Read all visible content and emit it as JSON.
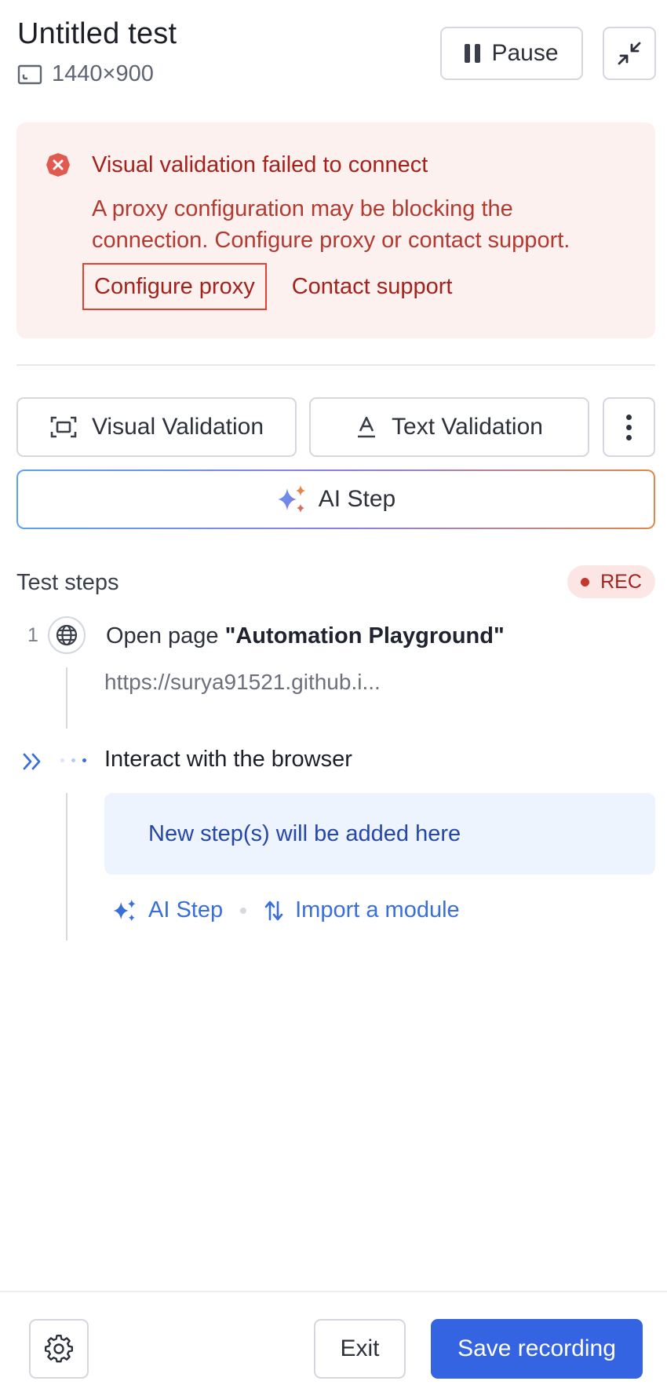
{
  "header": {
    "title": "Untitled test",
    "resolution": "1440×900",
    "pause_label": "Pause"
  },
  "alert": {
    "title": "Visual validation failed to connect",
    "body": "A proxy configuration may be blocking the connection. Configure proxy or contact support.",
    "configure_label": "Configure proxy",
    "contact_label": "Contact support",
    "color": "#a3231c"
  },
  "validation": {
    "visual_label": "Visual Validation",
    "text_label": "Text Validation"
  },
  "ai_step_label": "AI Step",
  "steps": {
    "title": "Test steps",
    "rec_label": "REC",
    "items": [
      {
        "number": "1",
        "prefix": "Open page ",
        "name": "\"Automation Playground\"",
        "url": "https://surya91521.github.i..."
      },
      {
        "title": "Interact with the browser"
      }
    ],
    "placeholder": "New step(s) will be added here",
    "quick_ai_label": "AI Step",
    "import_label": "Import a module"
  },
  "footer": {
    "exit_label": "Exit",
    "save_label": "Save recording",
    "accent_color": "#3564e3"
  }
}
